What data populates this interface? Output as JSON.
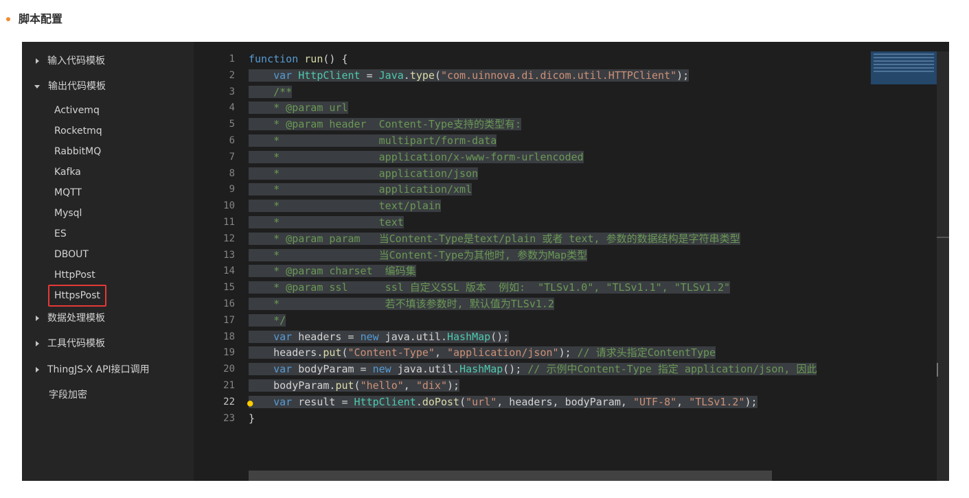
{
  "section": {
    "title": "脚本配置"
  },
  "sidebar": {
    "items": [
      {
        "label": "输入代码模板",
        "type": "folder",
        "state": "collapsed"
      },
      {
        "label": "输出代码模板",
        "type": "folder",
        "state": "expanded"
      },
      {
        "label": "Activemq",
        "type": "leaf"
      },
      {
        "label": "Rocketmq",
        "type": "leaf"
      },
      {
        "label": "RabbitMQ",
        "type": "leaf"
      },
      {
        "label": "Kafka",
        "type": "leaf"
      },
      {
        "label": "MQTT",
        "type": "leaf"
      },
      {
        "label": "Mysql",
        "type": "leaf"
      },
      {
        "label": "ES",
        "type": "leaf"
      },
      {
        "label": "DBOUT",
        "type": "leaf"
      },
      {
        "label": "HttpPost",
        "type": "leaf"
      },
      {
        "label": "HttpsPost",
        "type": "leaf",
        "selected": true
      },
      {
        "label": "数据处理模板",
        "type": "folder",
        "state": "collapsed"
      },
      {
        "label": "工具代码模板",
        "type": "folder",
        "state": "collapsed"
      },
      {
        "label": "ThingJS-X API接口调用",
        "type": "folder",
        "state": "collapsed"
      },
      {
        "label": "字段加密",
        "type": "folder",
        "state": "none"
      }
    ]
  },
  "editor": {
    "active_line": 22,
    "line_numbers": [
      "1",
      "2",
      "3",
      "4",
      "5",
      "6",
      "7",
      "8",
      "9",
      "10",
      "11",
      "12",
      "13",
      "14",
      "15",
      "16",
      "17",
      "18",
      "19",
      "20",
      "21",
      "22",
      "23"
    ],
    "lines": [
      "function run() {",
      "    var HttpClient = Java.type(\"com.uinnova.di.dicom.util.HTTPClient\");",
      "    /**",
      "    * @param url",
      "    * @param header  Content-Type支持的类型有:",
      "    *                multipart/form-data",
      "    *                application/x-www-form-urlencoded",
      "    *                application/json",
      "    *                application/xml",
      "    *                text/plain",
      "    *                text",
      "    * @param param   当Content-Type是text/plain 或者 text, 参数的数据结构是字符串类型",
      "    *                当Content-Type为其他时, 参数为Map类型",
      "    * @param charset  编码集",
      "    * @param ssl      ssl 自定义SSL 版本  例如:  \"TLSv1.0\", \"TLSv1.1\", \"TLSv1.2\"",
      "    *                 若不填该参数时, 默认值为TLSv1.2",
      "    */",
      "    var headers = new java.util.HashMap();",
      "    headers.put(\"Content-Type\", \"application/json\"); // 请求头指定ContentType",
      "    var bodyParam = new java.util.HashMap(); // 示例中Content-Type 指定 application/json, 因此",
      "    bodyParam.put(\"hello\", \"dix\");",
      "    var result = HttpClient.doPost(\"url\", headers, bodyParam, \"UTF-8\", \"TLSv1.2\");",
      "}"
    ]
  },
  "icons": {
    "lightbulb": "lightbulb-icon"
  },
  "colors": {
    "accent": "#f08c2e",
    "selection_border": "#e53935",
    "editor_bg": "#1e1e1e",
    "sidebar_bg": "#252526"
  }
}
